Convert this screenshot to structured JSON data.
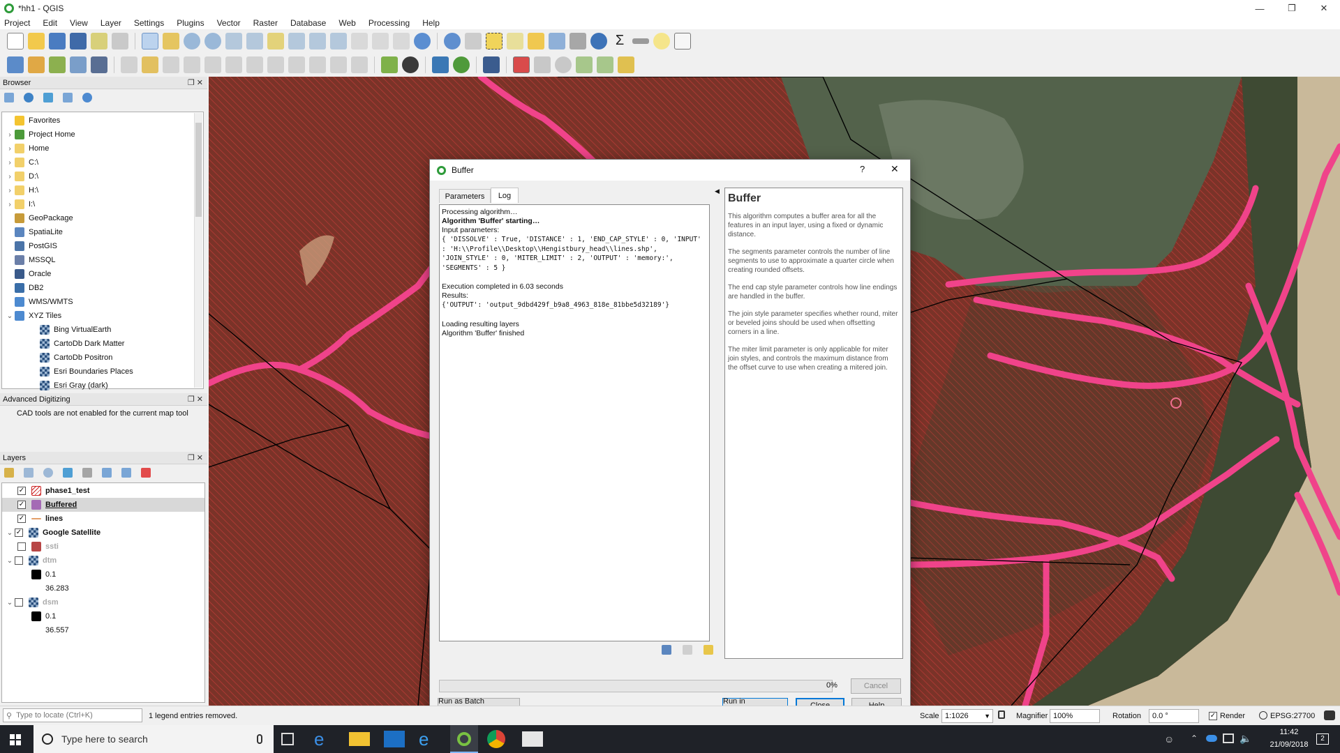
{
  "window": {
    "title": "*hh1 - QGIS"
  },
  "menu": [
    "Project",
    "Edit",
    "View",
    "Layer",
    "Settings",
    "Plugins",
    "Vector",
    "Raster",
    "Database",
    "Web",
    "Processing",
    "Help"
  ],
  "browser": {
    "title": "Browser",
    "items": [
      {
        "label": "Favorites",
        "icon": "star-icon"
      },
      {
        "label": "Project Home",
        "icon": "project-home-icon"
      },
      {
        "label": "Home",
        "icon": "folder-icon"
      },
      {
        "label": "C:\\",
        "icon": "folder-icon"
      },
      {
        "label": "D:\\",
        "icon": "folder-icon"
      },
      {
        "label": "H:\\",
        "icon": "folder-icon"
      },
      {
        "label": "I:\\",
        "icon": "folder-icon"
      },
      {
        "label": "GeoPackage",
        "icon": "geopackage-icon"
      },
      {
        "label": "SpatiaLite",
        "icon": "spatialite-icon"
      },
      {
        "label": "PostGIS",
        "icon": "postgis-icon"
      },
      {
        "label": "MSSQL",
        "icon": "mssql-icon"
      },
      {
        "label": "Oracle",
        "icon": "oracle-icon"
      },
      {
        "label": "DB2",
        "icon": "db2-icon"
      },
      {
        "label": "WMS/WMTS",
        "icon": "wms-icon"
      },
      {
        "label": "XYZ Tiles",
        "icon": "xyz-icon"
      },
      {
        "label": "Bing VirtualEarth",
        "icon": "tile-icon"
      },
      {
        "label": "CartoDb Dark Matter",
        "icon": "tile-icon"
      },
      {
        "label": "CartoDb Positron",
        "icon": "tile-icon"
      },
      {
        "label": "Esri Boundaries Places",
        "icon": "tile-icon"
      },
      {
        "label": "Esri Gray (dark)",
        "icon": "tile-icon"
      }
    ]
  },
  "advanced_digitizing": {
    "title": "Advanced Digitizing",
    "message": "CAD tools are not enabled for the current map tool"
  },
  "layers": {
    "title": "Layers",
    "items": [
      {
        "label": "phase1_test",
        "checked": true
      },
      {
        "label": "Buffered",
        "checked": true
      },
      {
        "label": "lines",
        "checked": true
      },
      {
        "label": "Google Satellite",
        "checked": true
      },
      {
        "label": "ssti",
        "checked": false
      },
      {
        "label": "dtm",
        "checked": false
      },
      {
        "label": "0.1"
      },
      {
        "label": "36.283"
      },
      {
        "label": "dsm",
        "checked": false
      },
      {
        "label": "0.1"
      },
      {
        "label": "36.557"
      }
    ]
  },
  "dialog": {
    "title": "Buffer",
    "help_glyph": "?",
    "close_glyph": "✕",
    "tabs": [
      "Parameters",
      "Log"
    ],
    "log": {
      "line1": "Processing algorithm…",
      "line2": "Algorithm 'Buffer' starting…",
      "line3": "Input parameters:",
      "params": "{ 'DISSOLVE' : True, 'DISTANCE' : 1, 'END_CAP_STYLE' : 0, 'INPUT' : 'H:\\\\Profile\\\\Desktop\\\\Hengistbury_head\\\\lines.shp', 'JOIN_STYLE' : 0, 'MITER_LIMIT' : 2, 'OUTPUT' : 'memory:', 'SEGMENTS' : 5 }",
      "line4": "Execution completed in 6.03 seconds",
      "line5": "Results:",
      "results": "{'OUTPUT': 'output_9dbd429f_b9a8_4963_818e_81bbe5d32189'}",
      "line6": "Loading resulting layers",
      "line7": "Algorithm 'Buffer' finished"
    },
    "help": {
      "heading": "Buffer",
      "p1": "This algorithm computes a buffer area for all the features in an input layer, using a fixed or dynamic distance.",
      "p2": "The segments parameter controls the number of line segments to use to approximate a quarter circle when creating rounded offsets.",
      "p3": "The end cap style parameter controls how line endings are handled in the buffer.",
      "p4": "The join style parameter specifies whether round, miter or beveled joins should be used when offsetting corners in a line.",
      "p5": "The miter limit parameter is only applicable for miter join styles, and controls the maximum distance from the offset curve to use when creating a mitered join."
    },
    "progress_fraction": 0,
    "progress_label": "0%",
    "cancel": "Cancel",
    "batch": "Run as Batch Process…",
    "run_bg": "Run in Background",
    "close": "Close",
    "helpbtn": "Help"
  },
  "statusbar": {
    "locate_placeholder": "Type to locate (Ctrl+K)",
    "message": "1 legend entries removed.",
    "scale_label": "Scale",
    "scale": "1:1026",
    "magnifier_label": "Magnifier",
    "magnifier": "100%",
    "rotation_label": "Rotation",
    "rotation": "0.0 °",
    "render_label": "Render",
    "crs": "EPSG:27700"
  },
  "taskbar": {
    "search": "Type here to search",
    "time": "11:42",
    "date": "21/09/2018",
    "notifications": "2"
  }
}
